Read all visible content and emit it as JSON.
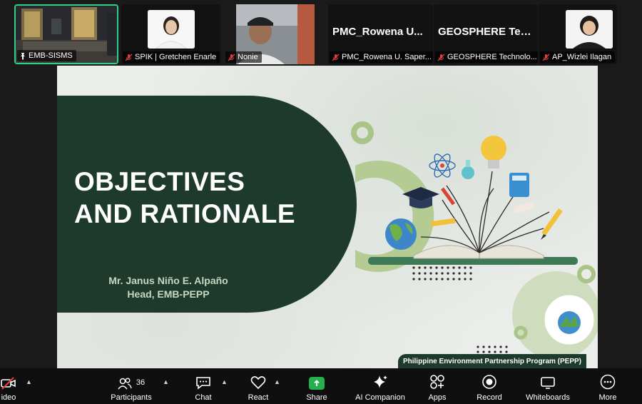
{
  "gallery": {
    "tiles": [
      {
        "name": "EMB-SISMS",
        "muted": false
      },
      {
        "name": "SPIK | Gretchen Enarle",
        "muted": true
      },
      {
        "name": "Nonie",
        "muted": true
      },
      {
        "name": "PMC_Rowena U. Saper...",
        "display_name": "PMC_Rowena U...",
        "muted": true
      },
      {
        "name": "GEOSPHERE Technolo...",
        "display_name": "GEOSPHERE Tec...",
        "muted": true
      },
      {
        "name": "AP_Wizlei Ilagan",
        "muted": true
      }
    ]
  },
  "slide": {
    "title_line1": "OBJECTIVES",
    "title_line2": "AND RATIONALE",
    "presenter_name": "Mr. Janus Niño E. Alpaño",
    "presenter_role": "Head, EMB-PEPP",
    "footer": "Philippine Environment Partnership Program (PEPP)",
    "logo_text": "PHILIPPINE ENVIRONMENT PARTNERSHIP PROGRAM"
  },
  "toolbar": {
    "video_label": "ideo",
    "participants_label": "Participants",
    "participants_count": "36",
    "chat_label": "Chat",
    "react_label": "React",
    "share_label": "Share",
    "ai_label": "AI Companion",
    "apps_label": "Apps",
    "record_label": "Record",
    "whiteboards_label": "Whiteboards",
    "more_label": "More"
  },
  "colors": {
    "active_border": "#2fd08a",
    "slide_green": "#1e3a2c",
    "accent_green": "#a9c486",
    "share_green": "#25b04f",
    "mute_red": "#e04040"
  }
}
